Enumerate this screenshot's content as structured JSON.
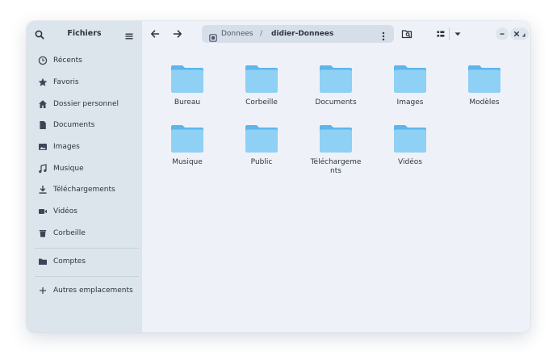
{
  "sidebar": {
    "title": "Fichiers",
    "places": [
      {
        "label": "Récents",
        "icon": "clock-icon"
      },
      {
        "label": "Favoris",
        "icon": "star-icon"
      },
      {
        "label": "Dossier personnel",
        "icon": "home-icon"
      },
      {
        "label": "Documents",
        "icon": "document-icon"
      },
      {
        "label": "Images",
        "icon": "image-icon"
      },
      {
        "label": "Musique",
        "icon": "music-icon"
      },
      {
        "label": "Téléchargements",
        "icon": "download-icon"
      },
      {
        "label": "Vidéos",
        "icon": "video-icon"
      },
      {
        "label": "Corbeille",
        "icon": "trash-icon"
      }
    ],
    "bookmarks": [
      {
        "label": "Comptes",
        "icon": "folder-icon"
      }
    ],
    "other_locations": {
      "label": "Autres emplacements",
      "icon": "plus-icon"
    }
  },
  "pathbar": {
    "segments": [
      "Donnees",
      "didier-Donnees"
    ],
    "separator": "/"
  },
  "files": [
    {
      "name": "Bureau"
    },
    {
      "name": "Corbeille"
    },
    {
      "name": "Documents"
    },
    {
      "name": "Images"
    },
    {
      "name": "Modèles"
    },
    {
      "name": "Musique"
    },
    {
      "name": "Public"
    },
    {
      "name": "Téléchargements"
    },
    {
      "name": "Vidéos"
    }
  ],
  "colors": {
    "folder_body": "#8fd0f5",
    "folder_tab": "#5cb6ec",
    "sidebar_bg": "#dce4ec",
    "content_bg": "#eef2f8",
    "icon": "#3d4656"
  }
}
